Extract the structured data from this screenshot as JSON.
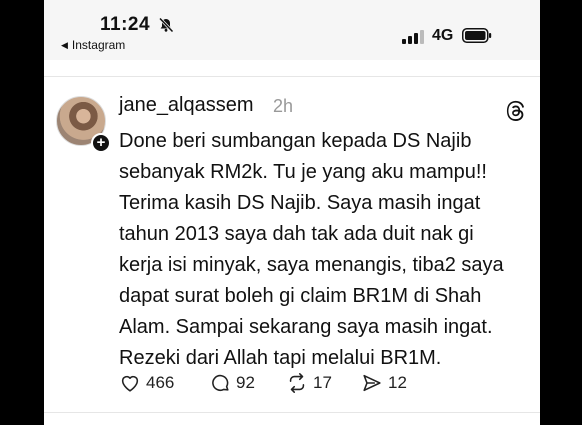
{
  "status_bar": {
    "time": "11:24",
    "back_label": "Instagram",
    "network": "4G"
  },
  "post": {
    "username": "jane_alqassem",
    "time": "2h",
    "lines": [
      "Done beri sumbangan kepada DS Najib",
      "sebanyak RM2k. Tu je yang aku mampu!!",
      "Terima kasih DS Najib. Saya masih ingat",
      "tahun 2013 saya dah tak ada duit nak gi",
      "kerja isi minyak, saya menangis, tiba2 saya",
      "dapat surat boleh gi claim BR1M di Shah",
      "Alam. Sampai sekarang saya masih ingat.",
      "Rezeki dari Allah tapi melalui BR1M."
    ],
    "likes": "466",
    "replies": "92",
    "reposts": "17",
    "shares": "12"
  },
  "icons": {
    "bell": "bell-slash-icon",
    "signal": "signal-bars-icon",
    "battery": "battery-icon",
    "threads": "threads-logo-icon",
    "like": "heart-icon",
    "reply": "comment-icon",
    "repost": "repost-icon",
    "share": "send-icon"
  }
}
